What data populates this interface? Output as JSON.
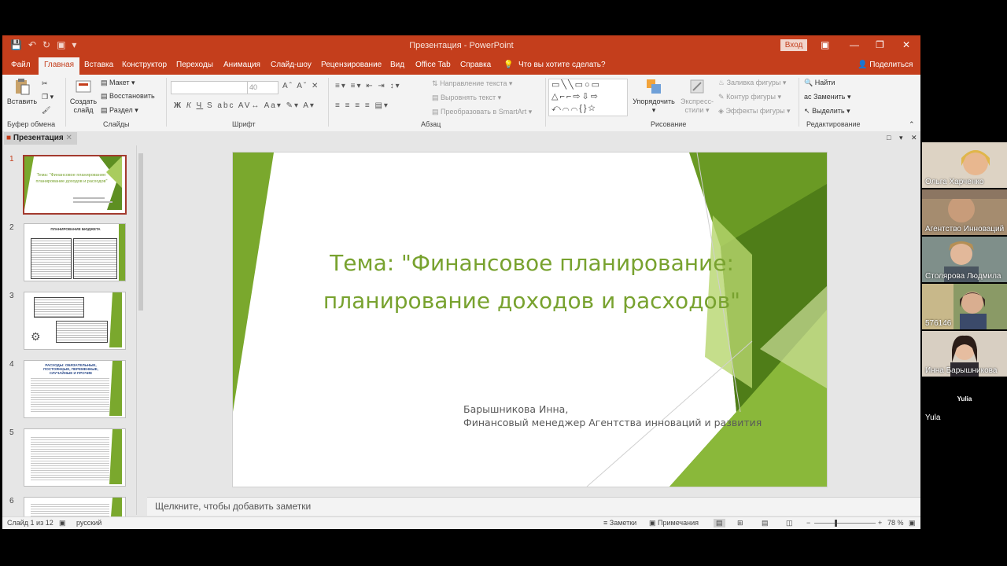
{
  "window": {
    "title": "Презентация  -  PowerPoint",
    "signin_label": "Вход"
  },
  "menu": {
    "items": [
      "Файл",
      "Главная",
      "Вставка",
      "Конструктор",
      "Переходы",
      "Анимация",
      "Слайд-шоу",
      "Рецензирование",
      "Вид",
      "Office Tab",
      "Справка"
    ],
    "active": "Главная",
    "search_placeholder": "Что вы хотите сделать?",
    "share_label": "Поделиться"
  },
  "ribbon": {
    "paste_label": "Вставить",
    "clipboard_label": "Буфер обмена",
    "new_slide_label": "Создать слайд",
    "layout_label": "Макет",
    "reset_label": "Восстановить",
    "section_label": "Раздел",
    "slides_label": "Слайды",
    "font_size": "40",
    "font_label": "Шрифт",
    "text_direction_label": "Направление текста",
    "align_text_label": "Выровнять текст",
    "smartart_label": "Преобразовать в SmartArt",
    "paragraph_label": "Абзац",
    "arrange_label": "Упорядочить",
    "quick_styles_label": "Экспресс-стили",
    "shape_fill_label": "Заливка фигуры",
    "shape_outline_label": "Контур фигуры",
    "shape_effects_label": "Эффекты фигуры",
    "drawing_label": "Рисование",
    "find_label": "Найти",
    "replace_label": "Заменить",
    "select_label": "Выделить",
    "editing_label": "Редактирование"
  },
  "panel": {
    "tab_label": "Презентация"
  },
  "thumbnails": [
    {
      "num": "1",
      "title": "Тема: \"Финансовое планирование: планирование доходов и расходов\""
    },
    {
      "num": "2",
      "title": "ПЛАНИРОВАНИЕ БЮДЖЕТА"
    },
    {
      "num": "3",
      "title": ""
    },
    {
      "num": "4",
      "title": "РАСХОДЫ: ОБЯЗАТЕЛЬНЫЕ, ПОСТОЯННЫЕ, ПЕРЕМЕННЫЕ, СЛУЧАЙНЫЕ И ПРОЧИЕ"
    },
    {
      "num": "5",
      "title": ""
    },
    {
      "num": "6",
      "title": ""
    }
  ],
  "slide": {
    "title_line1": "Тема: \"Финансовое планирование:",
    "title_line2": "планирование доходов и расходов\"",
    "author_line1": "Барышникова Инна,",
    "author_line2": "Финансовый менеджер Агентства инноваций и развития"
  },
  "notes_placeholder": "Щелкните, чтобы добавить заметки",
  "status": {
    "slide_info": "Слайд 1 из 12",
    "language": "русский",
    "notes_label": "Заметки",
    "comments_label": "Примечания",
    "zoom": "78 %"
  },
  "participants": [
    {
      "name": "Ольга Харченко",
      "bg": "#8a7a6a"
    },
    {
      "name": "Агентство Инноваций",
      "bg": "#9d8a75"
    },
    {
      "name": "Столярова Людмила",
      "bg": "#7d8a85"
    },
    {
      "name": "576146",
      "bg": "#6f7d5a"
    },
    {
      "name": "Инна Барышникова",
      "bg": "#b8a48c"
    },
    {
      "name": "Yula",
      "bg": "#000000",
      "center_name": "Yulia"
    }
  ],
  "colors": {
    "brand": "#c43e1c",
    "slide_green": "#78a22f"
  }
}
